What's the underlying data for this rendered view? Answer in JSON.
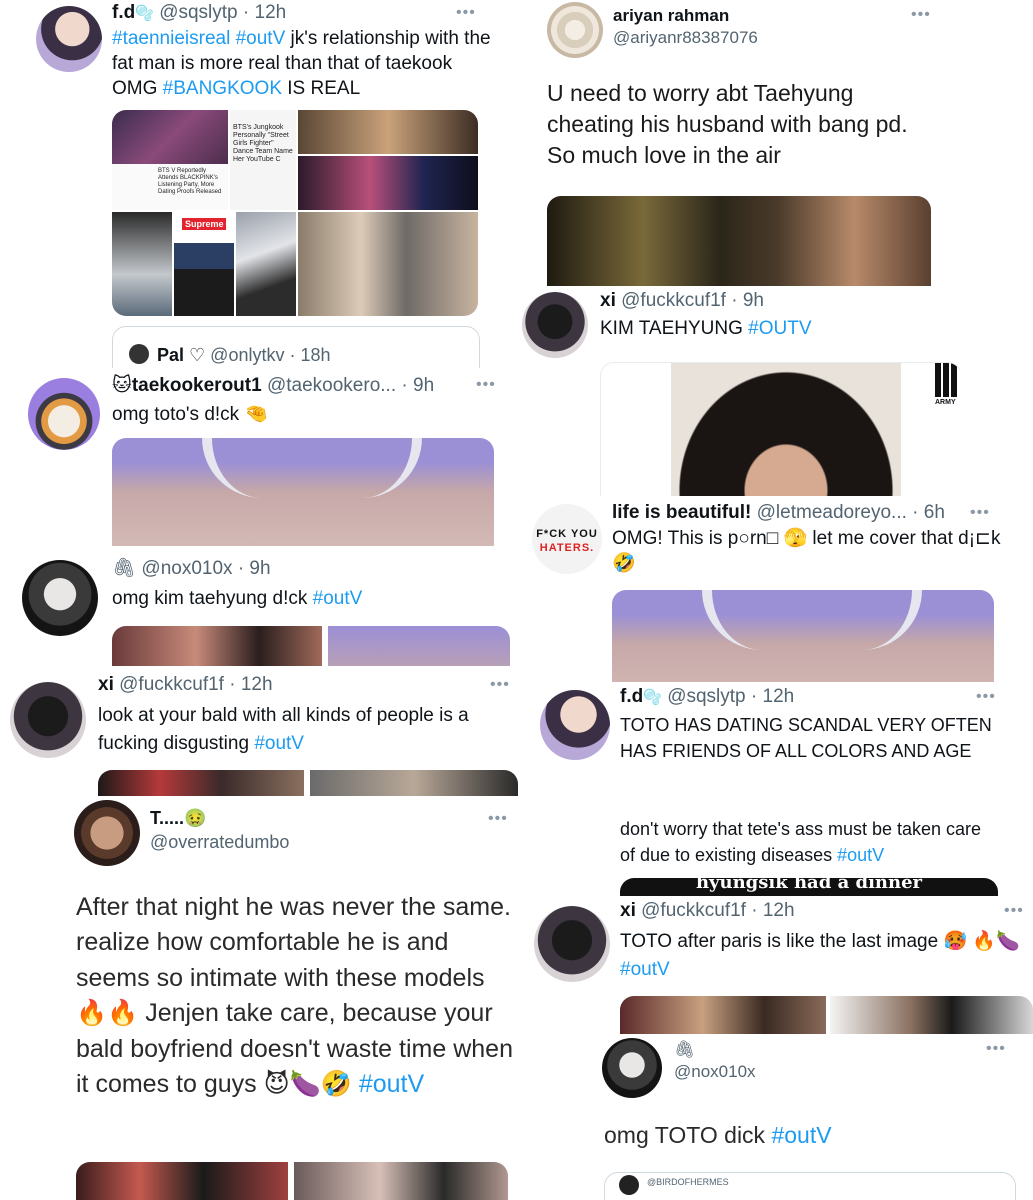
{
  "t1": {
    "name": "f.d",
    "emoji": "🫧",
    "handle": "@sqslytp",
    "time": "· 12h",
    "tag1": "#taennieisreal",
    "tag2": "#outV",
    "text_a": " jk's relationship with the fat man is more real than that of taekook OMG ",
    "tag3": "#BANGKOOK",
    "text_b": " IS REAL",
    "quote_name": "Pal ♡",
    "quote_handle": "@onlytkv · 18h",
    "media_caption": "BTS's Jungkook Personally \"Street Girls Fighter\" Dance Team Name Her YouTube C",
    "media_caption2": "BTS V Reportedly Attends BLACKPINK's Listening Party, More Dating Proofs Released",
    "media_brand": "Supreme"
  },
  "t2": {
    "name": "ariyan rahman",
    "handle": "@ariyanr88387076",
    "text": "U need to worry abt Taehyung cheating his husband with bang pd. So much love in the air"
  },
  "t3": {
    "name": "xi",
    "handle": "@fuckkcuf1f",
    "time": "· 9h",
    "text": "KIM TAEHYUNG ",
    "tag": "#OUTV",
    "media_brand": "ARMY"
  },
  "t4": {
    "name": "taekookerout1",
    "handle": "@taekookero...",
    "time": "· 9h",
    "text": "omg toto's d!ck 🤏"
  },
  "t5": {
    "name": "life is beautiful!",
    "handle": "@letmeadoreyo...",
    "time": "· 6h",
    "avatar_line1": "F*CK YOU",
    "avatar_line2": "HATERS.",
    "text": "OMG! This is p○rn□ 🫣 let me cover that d¡⊏k 🤣"
  },
  "t6": {
    "handle": "@nox010x",
    "time": "· 9h",
    "text": "omg kim taehyung d!ck ",
    "tag": "#outV"
  },
  "t7": {
    "name": "xi",
    "handle": "@fuckkcuf1f",
    "time": "· 12h",
    "text": "look at your bald with all kinds of people is a fucking disgusting ",
    "tag": "#outV"
  },
  "t8": {
    "name": "f.d",
    "emoji": "🫧",
    "handle": "@sqslytp",
    "time": "· 12h",
    "text1": "TOTO HAS DATING SCANDAL VERY OFTEN HAS FRIENDS OF ALL COLORS AND AGE",
    "text2": "don't worry that tete's ass must be taken care of due to existing diseases ",
    "tag": "#outV",
    "media_caption": "hyungsik had a dinner"
  },
  "t9": {
    "name": "T.....",
    "emoji": "🤢",
    "handle": "@overratedumbo",
    "text": "After that night he was never the same.  realize how comfortable he is and seems so intimate with these models 🔥🔥 Jenjen take care, because your bald boyfriend doesn't waste time when it comes to guys 😈🍆🤣 ",
    "tag": "#outV"
  },
  "t10": {
    "name": "xi",
    "handle": "@fuckkcuf1f",
    "time": "· 12h",
    "text": "TOTO after paris is like the last image 🥵 🔥🍆 ",
    "tag": "#outV"
  },
  "t11": {
    "handle": "@nox010x",
    "text": "omg TOTO dick ",
    "tag": "#outV",
    "quote_handle": "@BIRDOFHERMES"
  },
  "more_glyph": "•••",
  "colors": {
    "link": "#1d9bf0",
    "text": "#0f1419",
    "secondary": "#536471",
    "border": "#cfd9de"
  }
}
